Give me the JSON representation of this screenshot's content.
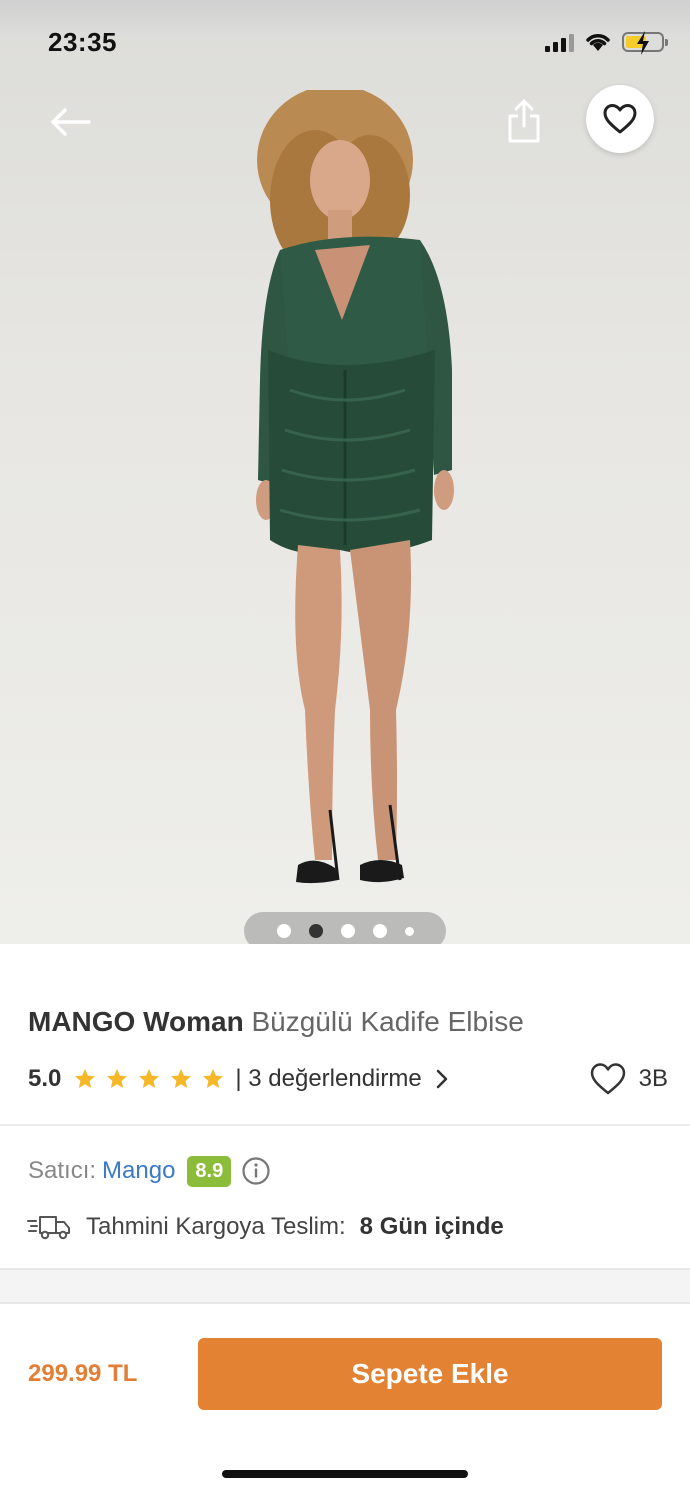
{
  "status_bar": {
    "time": "23:35"
  },
  "header": {
    "back_icon": "arrow-left-icon",
    "share_icon": "share-icon",
    "favorite_icon": "heart-outline-icon"
  },
  "gallery": {
    "image_count": 5,
    "active_index": 1
  },
  "product": {
    "brand": "MANGO Woman",
    "name": "Büzgülü Kadife Elbise",
    "rating": "5.0",
    "stars": 5,
    "review_text": "| 3 değerlendirme",
    "favorite_count": "3B"
  },
  "seller": {
    "label": "Satıcı:",
    "name": "Mango",
    "score": "8.9"
  },
  "shipping": {
    "label": "Tahmini Kargoya Teslim:",
    "value": "8 Gün içinde"
  },
  "bottom_bar": {
    "price": "299.99 TL",
    "add_to_cart": "Sepete Ekle"
  },
  "colors": {
    "accent_orange": "#e38233",
    "price_orange": "#e07f35",
    "seller_blue": "#3b79c9",
    "score_green": "#8bbd3a",
    "star_yellow": "#f5b82a"
  }
}
